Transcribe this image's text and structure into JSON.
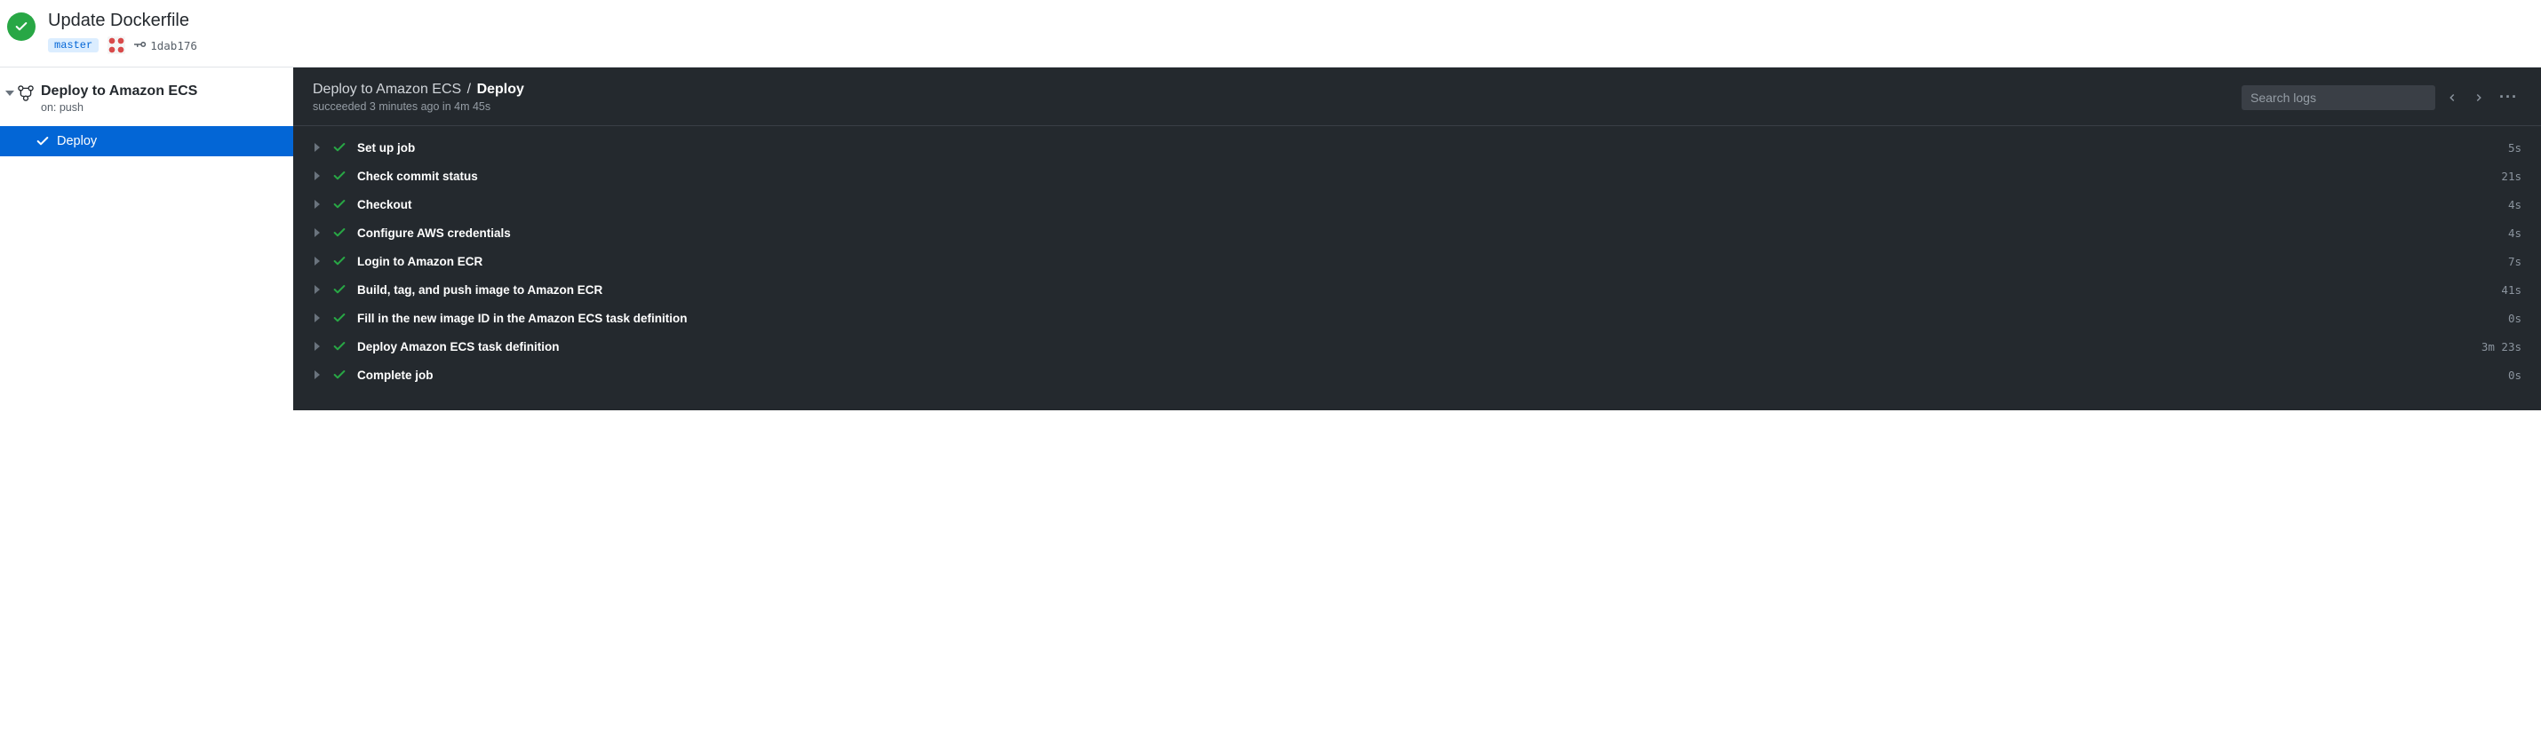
{
  "header": {
    "title": "Update Dockerfile",
    "branch": "master",
    "sha": "1dab176"
  },
  "sidebar": {
    "workflow_name": "Deploy to Amazon ECS",
    "trigger": "on: push",
    "job_name": "Deploy"
  },
  "panel": {
    "crumb_workflow": "Deploy to Amazon ECS",
    "crumb_sep": "/",
    "crumb_job": "Deploy",
    "status_line": "succeeded 3 minutes ago in 4m 45s",
    "search_placeholder": "Search logs"
  },
  "steps": [
    {
      "name": "Set up job",
      "duration": "5s"
    },
    {
      "name": "Check commit status",
      "duration": "21s"
    },
    {
      "name": "Checkout",
      "duration": "4s"
    },
    {
      "name": "Configure AWS credentials",
      "duration": "4s"
    },
    {
      "name": "Login to Amazon ECR",
      "duration": "7s"
    },
    {
      "name": "Build, tag, and push image to Amazon ECR",
      "duration": "41s"
    },
    {
      "name": "Fill in the new image ID in the Amazon ECS task definition",
      "duration": "0s"
    },
    {
      "name": "Deploy Amazon ECS task definition",
      "duration": "3m 23s"
    },
    {
      "name": "Complete job",
      "duration": "0s"
    }
  ]
}
